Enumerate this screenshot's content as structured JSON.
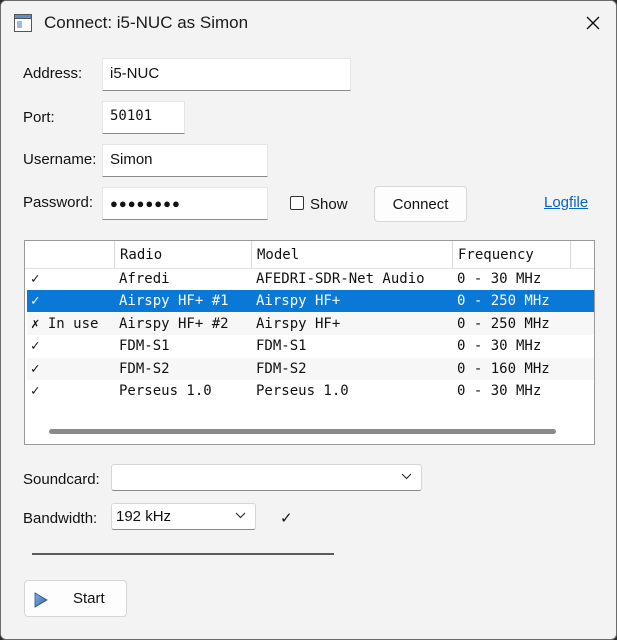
{
  "window": {
    "title": "Connect: i5-NUC as Simon"
  },
  "form": {
    "address_label": "Address:",
    "address_value": "i5-NUC",
    "port_label": "Port:",
    "port_value": "50101",
    "username_label": "Username:",
    "username_value": "Simon",
    "password_label": "Password:",
    "password_value": "●●●●●●●●",
    "show_label": "Show",
    "show_checked": false,
    "connect_label": "Connect",
    "logfile_label": "Logfile"
  },
  "table": {
    "columns": [
      "",
      "Radio",
      "Model",
      "Frequency"
    ],
    "rows": [
      {
        "status": "✓",
        "radio": "Afredi",
        "model": "AFEDRI-SDR-Net Audio",
        "frequency": "0 - 30 MHz",
        "selected": false
      },
      {
        "status": "✓",
        "radio": "Airspy HF+ #1",
        "model": "Airspy HF+",
        "frequency": "0 - 250 MHz",
        "selected": true
      },
      {
        "status": "✗ In use",
        "radio": "Airspy HF+ #2",
        "model": "Airspy HF+",
        "frequency": "0 - 250 MHz",
        "selected": false
      },
      {
        "status": "✓",
        "radio": "FDM-S1",
        "model": "FDM-S1",
        "frequency": "0 - 30 MHz",
        "selected": false
      },
      {
        "status": "✓",
        "radio": "FDM-S2",
        "model": "FDM-S2",
        "frequency": "0 - 160 MHz",
        "selected": false
      },
      {
        "status": "✓",
        "radio": "Perseus 1.0",
        "model": "Perseus 1.0",
        "frequency": "0 - 30 MHz",
        "selected": false
      }
    ]
  },
  "soundcard": {
    "label": "Soundcard:",
    "value": ""
  },
  "bandwidth": {
    "label": "Bandwidth:",
    "value": "192 kHz",
    "status": "✓"
  },
  "start": {
    "label": "Start"
  },
  "colors": {
    "selection": "#0a78d7",
    "link": "#0b63c5",
    "window_bg": "#f3f3f3"
  }
}
